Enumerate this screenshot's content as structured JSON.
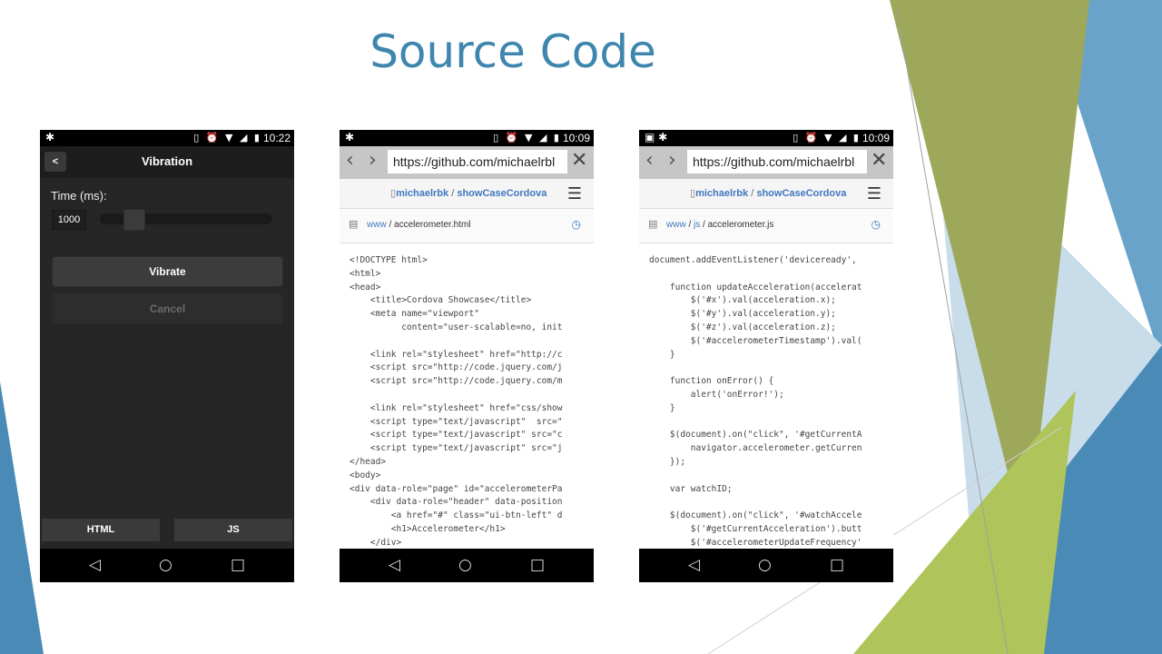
{
  "slide": {
    "title": "Source Code",
    "colors": {
      "title": "#3e86ad",
      "olive": "#9da85a",
      "lime": "#afc45a",
      "blue": "#4a8ab7",
      "light_blue": "#c8dcea"
    }
  },
  "status_bar": {
    "left_icon": "android-debug-icon",
    "icons": [
      "vibrate-icon",
      "alarm-icon",
      "wifi-icon",
      "signal-icon",
      "battery-icon"
    ]
  },
  "phones": [
    {
      "time": "10:22",
      "app": {
        "back_label": "<",
        "title": "Vibration",
        "time_label": "Time (ms):",
        "time_value": "1000",
        "slider_level": 0.18,
        "vibrate_label": "Vibrate",
        "cancel_label": "Cancel",
        "tabs": [
          "HTML",
          "JS"
        ]
      }
    },
    {
      "time": "10:09",
      "url": "https://github.com/michaelrbl",
      "repo_owner": "michaelrbk",
      "repo_sep": " / ",
      "repo_name": "showCaseCordova",
      "path_dir": "www",
      "path_sep": " / ",
      "file": "accelerometer.html",
      "code": [
        "<!DOCTYPE html>",
        "<html>",
        "<head>",
        "    <title>Cordova Showcase</title>",
        "    <meta name=\"viewport\"",
        "          content=\"user-scalable=no, init",
        "",
        "    <link rel=\"stylesheet\" href=\"http://c",
        "    <script src=\"http://code.jquery.com/j",
        "    <script src=\"http://code.jquery.com/m",
        "",
        "    <link rel=\"stylesheet\" href=\"css/show",
        "    <script type=\"text/javascript\"  src=\"",
        "    <script type=\"text/javascript\" src=\"c",
        "    <script type=\"text/javascript\" src=\"j",
        "</head>",
        "<body>",
        "<div data-role=\"page\" id=\"accelerometerPa",
        "    <div data-role=\"header\" data-position",
        "        <a href=\"#\" class=\"ui-btn-left\" d",
        "        <h1>Accelerometer</h1>",
        "    </div>"
      ]
    },
    {
      "time": "10:09",
      "extra_status_icon": "image-icon",
      "url": "https://github.com/michaelrbl",
      "repo_owner": "michaelrbk",
      "repo_sep": " / ",
      "repo_name": "showCaseCordova",
      "path_dir": "www",
      "path_sep": " / ",
      "path_dir2": "js",
      "file": "accelerometer.js",
      "code": [
        "document.addEventListener('deviceready',",
        "",
        "    function updateAcceleration(accelerat",
        "        $('#x').val(acceleration.x);",
        "        $('#y').val(acceleration.y);",
        "        $('#z').val(acceleration.z);",
        "        $('#accelerometerTimestamp').val(",
        "    }",
        "",
        "    function onError() {",
        "        alert('onError!');",
        "    }",
        "",
        "    $(document).on(\"click\", '#getCurrentA",
        "        navigator.accelerometer.getCurren",
        "    });",
        "",
        "    var watchID;",
        "",
        "    $(document).on(\"click\", '#watchAccele",
        "        $('#getCurrentAcceleration').butt",
        "        $('#accelerometerUpdateFrequency'"
      ]
    }
  ]
}
